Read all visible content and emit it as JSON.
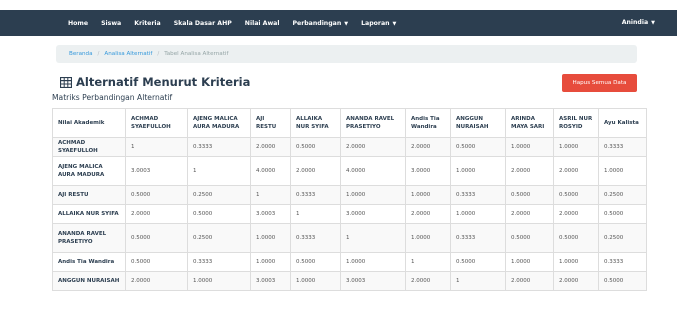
{
  "nav": {
    "items": [
      {
        "label": "Home",
        "dropdown": false
      },
      {
        "label": "Siswa",
        "dropdown": false
      },
      {
        "label": "Kriteria",
        "dropdown": false
      },
      {
        "label": "Skala Dasar AHP",
        "dropdown": false
      },
      {
        "label": "Nilai Awal",
        "dropdown": false
      },
      {
        "label": "Perbandingan",
        "dropdown": true
      },
      {
        "label": "Laporan",
        "dropdown": true
      }
    ],
    "user": "Anindia",
    "background": "#2c3e50"
  },
  "breadcrumb": {
    "items": [
      "Beranda",
      "Analisa Alternatif"
    ],
    "active": "Tabel Analisa Alternatif",
    "separator": "/"
  },
  "page": {
    "title": "Alternatif Menurut Kriteria",
    "title_icon": "table-icon",
    "subtitle": "Matriks Perbandingan Alternatif",
    "delete_button": "Hapus Semua Data",
    "danger_color": "#e74c3c"
  },
  "table": {
    "corner": "Nilai Akademik",
    "columns": [
      "ACHMAD SYAEFULLOH",
      "AJENG MALICA AURA MADURA",
      "AJI RESTU",
      "ALLAIKA NUR SYIFA",
      "ANANDA RAVEL PRASETIYO",
      "Andis Tia Wandira",
      "ANGGUN NURAISAH",
      "ARINDA MAYA SARI",
      "ASRIL NUR ROSYID",
      "Ayu Kalista"
    ],
    "rows": [
      {
        "name": "ACHMAD SYAEFULLOH",
        "values": [
          "1",
          "0.3333",
          "2.0000",
          "0.5000",
          "2.0000",
          "2.0000",
          "0.5000",
          "1.0000",
          "1.0000",
          "0.3333"
        ]
      },
      {
        "name": "AJENG MALICA AURA MADURA",
        "values": [
          "3.0003",
          "1",
          "4.0000",
          "2.0000",
          "4.0000",
          "3.0000",
          "1.0000",
          "2.0000",
          "2.0000",
          "1.0000"
        ]
      },
      {
        "name": "AJI RESTU",
        "values": [
          "0.5000",
          "0.2500",
          "1",
          "0.3333",
          "1.0000",
          "1.0000",
          "0.3333",
          "0.5000",
          "0.5000",
          "0.2500"
        ]
      },
      {
        "name": "ALLAIKA NUR SYIFA",
        "values": [
          "2.0000",
          "0.5000",
          "3.0003",
          "1",
          "3.0000",
          "2.0000",
          "1.0000",
          "2.0000",
          "2.0000",
          "0.5000"
        ]
      },
      {
        "name": "ANANDA RAVEL PRASETIYO",
        "values": [
          "0.5000",
          "0.2500",
          "1.0000",
          "0.3333",
          "1",
          "1.0000",
          "0.3333",
          "0.5000",
          "0.5000",
          "0.2500"
        ]
      },
      {
        "name": "Andis Tia Wandira",
        "values": [
          "0.5000",
          "0.3333",
          "1.0000",
          "0.5000",
          "1.0000",
          "1",
          "0.5000",
          "1.0000",
          "1.0000",
          "0.3333"
        ]
      },
      {
        "name": "ANGGUN NURAISAH",
        "values": [
          "2.0000",
          "1.0000",
          "3.0003",
          "1.0000",
          "3.0003",
          "2.0000",
          "1",
          "2.0000",
          "2.0000",
          "0.5000"
        ]
      }
    ]
  }
}
